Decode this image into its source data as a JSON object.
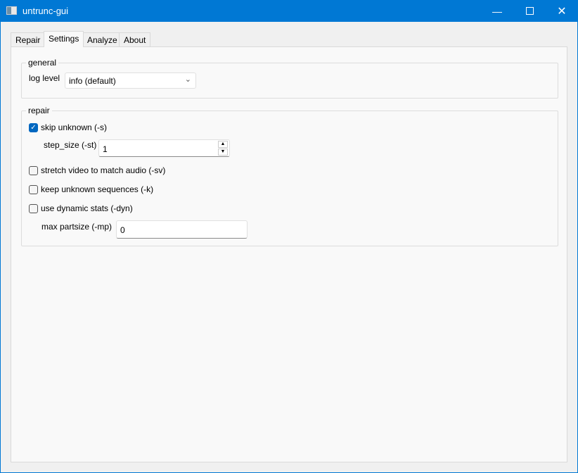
{
  "window": {
    "title": "untrunc-gui",
    "accent": "#0078d4"
  },
  "tabs": [
    {
      "label": "Repair"
    },
    {
      "label": "Settings"
    },
    {
      "label": "Analyze"
    },
    {
      "label": "About"
    }
  ],
  "general": {
    "title": "general",
    "log_level_label": "log level",
    "log_level_value": "info (default)"
  },
  "repair": {
    "title": "repair",
    "skip_unknown": {
      "label": "skip unknown (-s)",
      "checked": true
    },
    "step_size": {
      "label": "step_size (-st)",
      "value": "1"
    },
    "stretch_video": {
      "label": "stretch video to match audio (-sv)",
      "checked": false
    },
    "keep_unknown": {
      "label": "keep unknown sequences (-k)",
      "checked": false
    },
    "dynamic_stats": {
      "label": "use dynamic stats (-dyn)",
      "checked": false
    },
    "max_partsize": {
      "label": "max partsize (-mp)",
      "value": "0"
    }
  }
}
